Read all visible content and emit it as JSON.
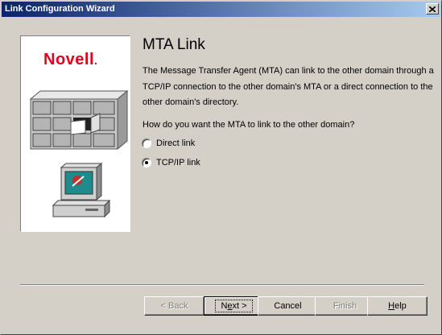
{
  "window": {
    "title": "Link Configuration Wizard"
  },
  "logo": {
    "text": "Novell",
    "dot": "."
  },
  "page": {
    "heading": "MTA Link",
    "description": "The Message Transfer Agent (MTA) can link to the other domain through a TCP/IP connection to the other domain's MTA or a direct connection to the other domain's directory.",
    "question": "How do you want the MTA to link to the other domain?",
    "options": [
      {
        "label": "Direct link",
        "checked": false
      },
      {
        "label": "TCP/IP link",
        "checked": true
      }
    ]
  },
  "buttons": {
    "back": {
      "label": "< Back",
      "enabled": false
    },
    "next_pre": "N",
    "next_ul": "e",
    "next_post": "xt >",
    "cancel": "Cancel",
    "finish": {
      "label": "Finish",
      "enabled": false
    },
    "help_ul": "H",
    "help_post": "elp"
  },
  "colors": {
    "title_start": "#0a246a",
    "title_end": "#a6caf0",
    "logo_red": "#e2001a",
    "face": "#d4d0c8"
  }
}
